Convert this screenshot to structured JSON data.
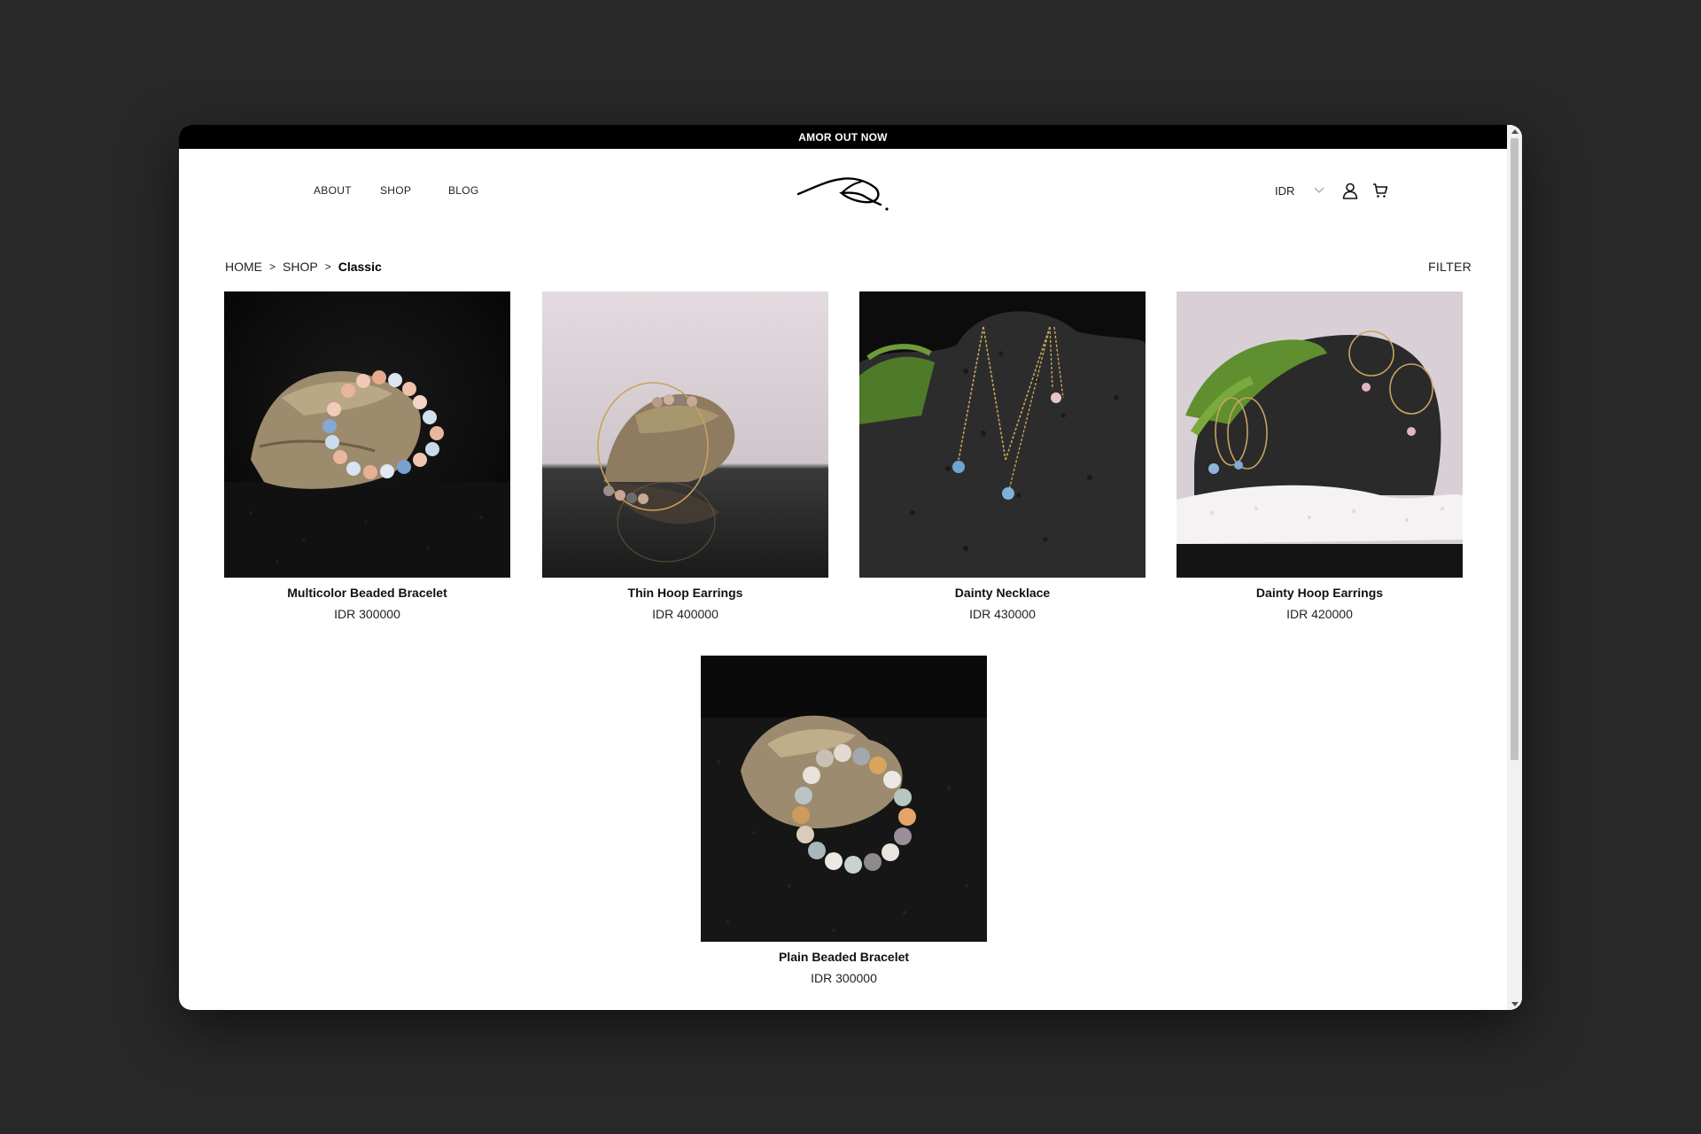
{
  "announcement": "AMOR OUT NOW",
  "nav": {
    "about": "ABOUT",
    "shop": "SHOP",
    "blog": "BLOG"
  },
  "header": {
    "currency": "IDR",
    "icons": [
      "chevron-down-icon",
      "user-icon",
      "cart-icon"
    ]
  },
  "breadcrumb": {
    "home": "HOME",
    "shop": "SHOP",
    "current": "Classic",
    "separator": ">"
  },
  "filter_label": "FILTER",
  "products": [
    {
      "name": "Multicolor Beaded Bracelet",
      "price": "IDR 300000"
    },
    {
      "name": "Thin Hoop Earrings",
      "price": "IDR 400000"
    },
    {
      "name": "Dainty Necklace",
      "price": "IDR 430000"
    },
    {
      "name": "Dainty Hoop Earrings",
      "price": "IDR 420000"
    },
    {
      "name": "Plain Beaded Bracelet",
      "price": "IDR 300000"
    }
  ],
  "colors": {
    "page_background": "#282828",
    "announcement_bar": "#000000",
    "text": "#111111"
  }
}
